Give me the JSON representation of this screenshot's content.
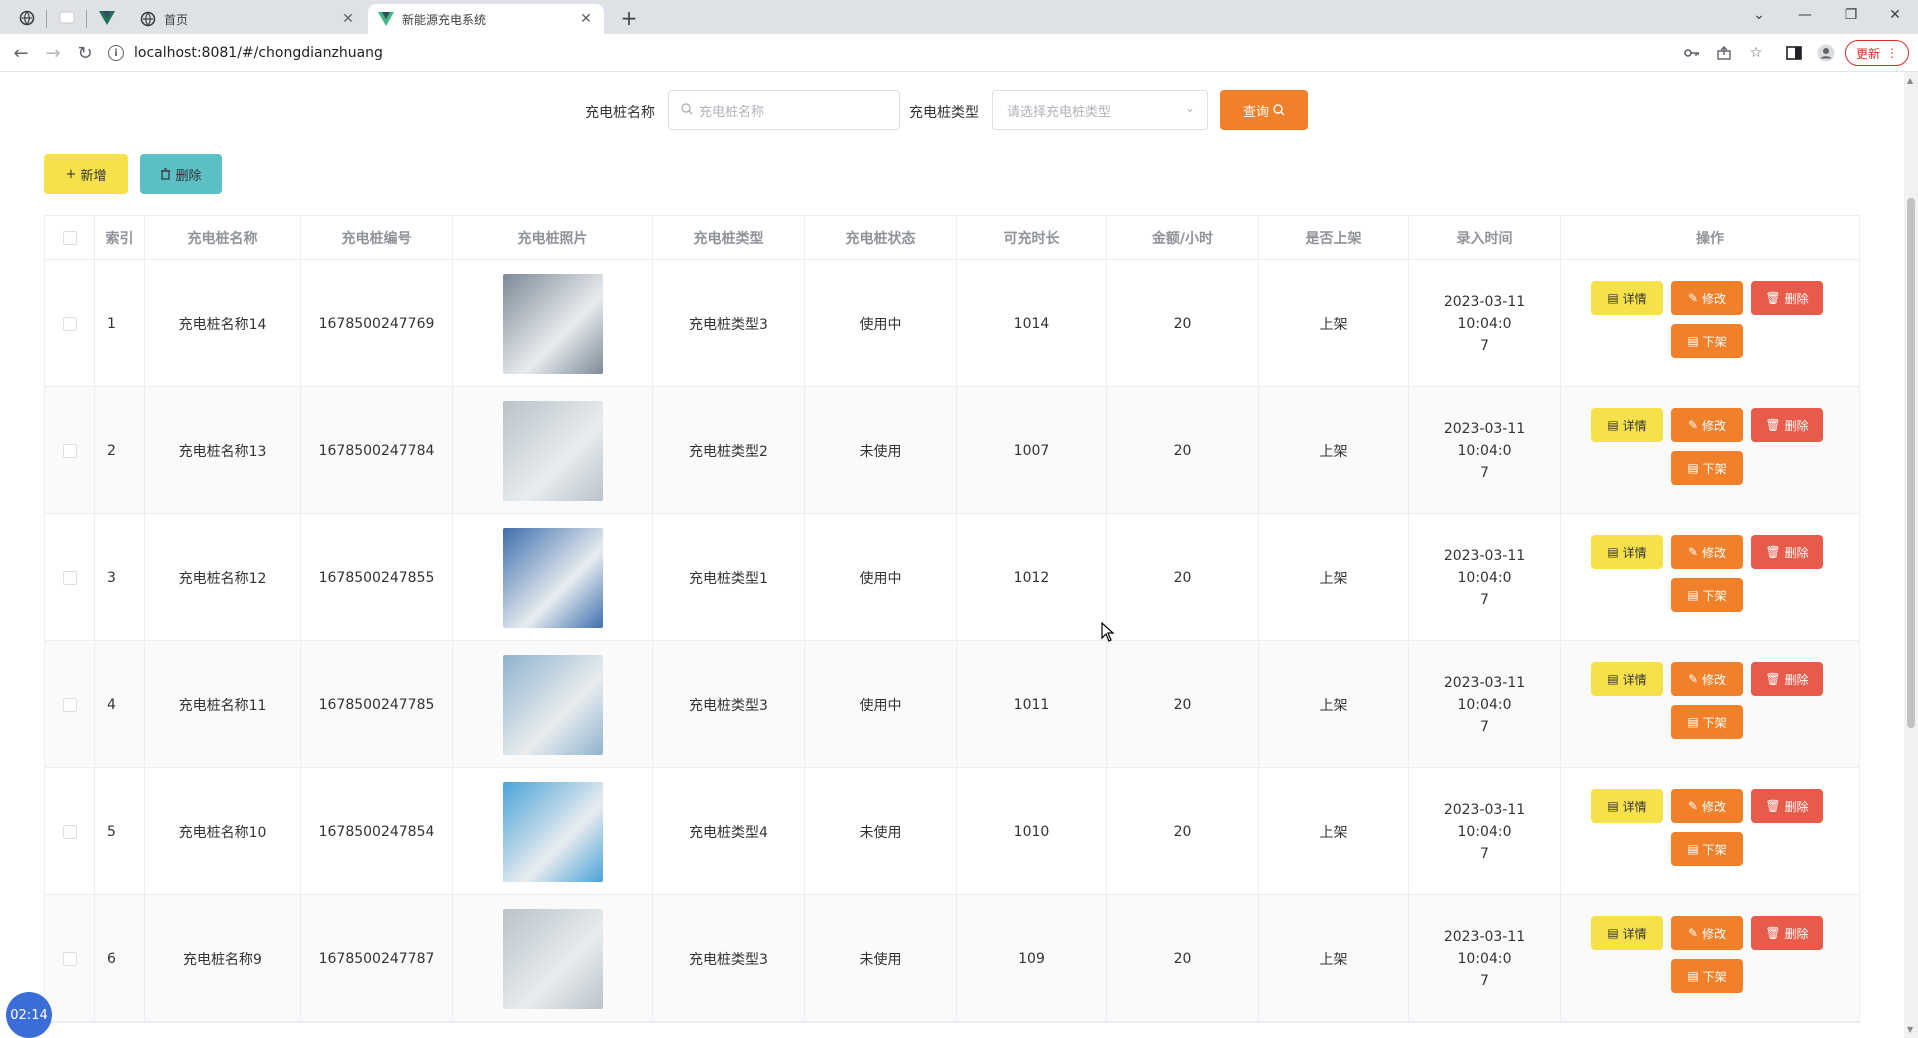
{
  "browser": {
    "tabs": [
      {
        "title": "首页",
        "active": false
      },
      {
        "title": "新能源充电系统",
        "active": true
      }
    ],
    "url": "localhost:8081/#/chongdianzhuang",
    "update_label": "更新"
  },
  "search": {
    "name_label": "充电桩名称",
    "name_placeholder": "充电桩名称",
    "type_label": "充电桩类型",
    "type_placeholder": "请选择充电桩类型",
    "query_label": "查询"
  },
  "actions": {
    "add_label": "新增",
    "delete_label": "删除"
  },
  "table": {
    "headers": [
      "索引",
      "充电桩名称",
      "充电桩编号",
      "充电桩照片",
      "充电桩类型",
      "充电桩状态",
      "可充时长",
      "金额/小时",
      "是否上架",
      "录入时间",
      "操作"
    ],
    "rows": [
      {
        "index": "1",
        "name": "充电桩名称14",
        "code": "1678500247769",
        "type": "充电桩类型3",
        "status": "使用中",
        "duration": "1014",
        "price": "20",
        "shelf": "上架",
        "time_a": "2023-03-11 10:04:0",
        "time_b": "7",
        "photo": "#7d8a97"
      },
      {
        "index": "2",
        "name": "充电桩名称13",
        "code": "1678500247784",
        "type": "充电桩类型2",
        "status": "未使用",
        "duration": "1007",
        "price": "20",
        "shelf": "上架",
        "time_a": "2023-03-11 10:04:0",
        "time_b": "7",
        "photo": "#b9c3c9"
      },
      {
        "index": "3",
        "name": "充电桩名称12",
        "code": "1678500247855",
        "type": "充电桩类型1",
        "status": "使用中",
        "duration": "1012",
        "price": "20",
        "shelf": "上架",
        "time_a": "2023-03-11 10:04:0",
        "time_b": "7",
        "photo": "#3d6fae"
      },
      {
        "index": "4",
        "name": "充电桩名称11",
        "code": "1678500247785",
        "type": "充电桩类型3",
        "status": "使用中",
        "duration": "1011",
        "price": "20",
        "shelf": "上架",
        "time_a": "2023-03-11 10:04:0",
        "time_b": "7",
        "photo": "#8fb3cc"
      },
      {
        "index": "5",
        "name": "充电桩名称10",
        "code": "1678500247854",
        "type": "充电桩类型4",
        "status": "未使用",
        "duration": "1010",
        "price": "20",
        "shelf": "上架",
        "time_a": "2023-03-11 10:04:0",
        "time_b": "7",
        "photo": "#4aa3d8"
      },
      {
        "index": "6",
        "name": "充电桩名称9",
        "code": "1678500247787",
        "type": "充电桩类型3",
        "status": "未使用",
        "duration": "109",
        "price": "20",
        "shelf": "上架",
        "time_a": "2023-03-11 10:04:0",
        "time_b": "7",
        "photo": "#b9c3c9"
      }
    ],
    "op_labels": {
      "detail": "详情",
      "edit": "修改",
      "delete": "删除",
      "down": "下架"
    }
  },
  "timer": "02:14",
  "colors": {
    "accent": "#f0802a",
    "yellow": "#f7e14a",
    "teal": "#5bbfc6",
    "red": "#e85b4a"
  }
}
